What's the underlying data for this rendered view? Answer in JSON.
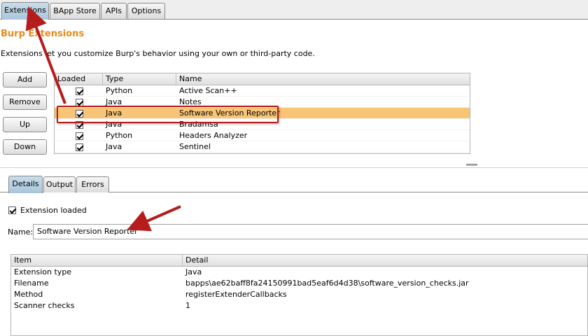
{
  "top_tabs": [
    "Extensions",
    "BApp Store",
    "APIs",
    "Options"
  ],
  "title": "Burp Extensions",
  "description": "Extensions let you customize Burp's behavior using your own or third-party code.",
  "buttons": {
    "add": "Add",
    "remove": "Remove",
    "up": "Up",
    "down": "Down"
  },
  "extensions_table": {
    "columns": [
      "Loaded",
      "Type",
      "Name"
    ],
    "rows": [
      {
        "loaded": true,
        "type": "Python",
        "name": "Active Scan++"
      },
      {
        "loaded": true,
        "type": "Java",
        "name": "Notes"
      },
      {
        "loaded": true,
        "type": "Java",
        "name": "Software Version Reporter",
        "selected": true
      },
      {
        "loaded": true,
        "type": "Java",
        "name": "Bradamsa"
      },
      {
        "loaded": true,
        "type": "Python",
        "name": "Headers Analyzer"
      },
      {
        "loaded": true,
        "type": "Java",
        "name": "Sentinel"
      }
    ]
  },
  "bottom_tabs": [
    "Details",
    "Output",
    "Errors"
  ],
  "details": {
    "extension_loaded_label": "Extension loaded",
    "extension_loaded": true,
    "name_label": "Name:",
    "name_value": "Software Version Reporter",
    "columns": [
      "Item",
      "Detail"
    ],
    "rows": [
      {
        "item": "Extension type",
        "detail": "Java"
      },
      {
        "item": "Filename",
        "detail": "bapps\\ae62baff8fa24150991bad5eaf6d4d38\\software_version_checks.jar"
      },
      {
        "item": "Method",
        "detail": "registerExtenderCallbacks"
      },
      {
        "item": "Scanner checks",
        "detail": "1"
      }
    ]
  },
  "colors": {
    "title": "#e88a1a",
    "selected_row": "#f8c576",
    "annotation": "#b71c1c"
  }
}
